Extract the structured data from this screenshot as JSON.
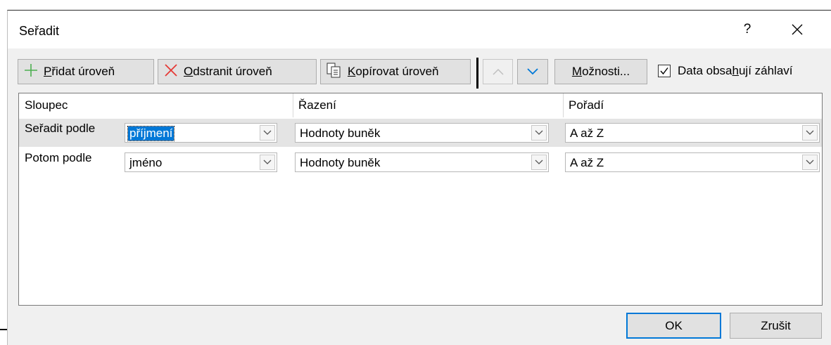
{
  "dialog": {
    "title": "Seřadit",
    "help_label": "?",
    "close_label": "×"
  },
  "toolbar": {
    "add_level": {
      "pre": "",
      "accel": "P",
      "post": "řidat úroveň"
    },
    "delete_level": {
      "pre": "",
      "accel": "O",
      "post": "dstranit úroveň"
    },
    "copy_level": {
      "pre": "",
      "accel": "K",
      "post": "opírovat úroveň"
    },
    "options": {
      "pre": "",
      "accel": "M",
      "post": "ožnosti..."
    },
    "header_checkbox": {
      "pre": "Data obsa",
      "accel": "h",
      "post": "ují záhlaví",
      "checked": true
    }
  },
  "grid": {
    "headers": [
      "Sloupec",
      "Řazení",
      "Pořadí"
    ],
    "rows": [
      {
        "label": "Seřadit podle",
        "column": "příjmení",
        "sort_on": "Hodnoty buněk",
        "order": "A až Z",
        "selected": true
      },
      {
        "label": "Potom podle",
        "column": "jméno",
        "sort_on": "Hodnoty buněk",
        "order": "A až Z",
        "selected": false
      }
    ]
  },
  "footer": {
    "ok_label": "OK",
    "cancel_label": "Zrušit"
  },
  "colors": {
    "accent": "#0078d7",
    "add_icon": "#4caf50",
    "delete_icon": "#e53935",
    "arrow_enabled": "#0078d7",
    "arrow_disabled": "#bfbfbf"
  },
  "icons": [
    "plus-icon",
    "x-icon",
    "copy-icon",
    "arrow-up-icon",
    "arrow-down-icon",
    "checkmark-icon",
    "chevron-down-icon",
    "close-icon"
  ]
}
